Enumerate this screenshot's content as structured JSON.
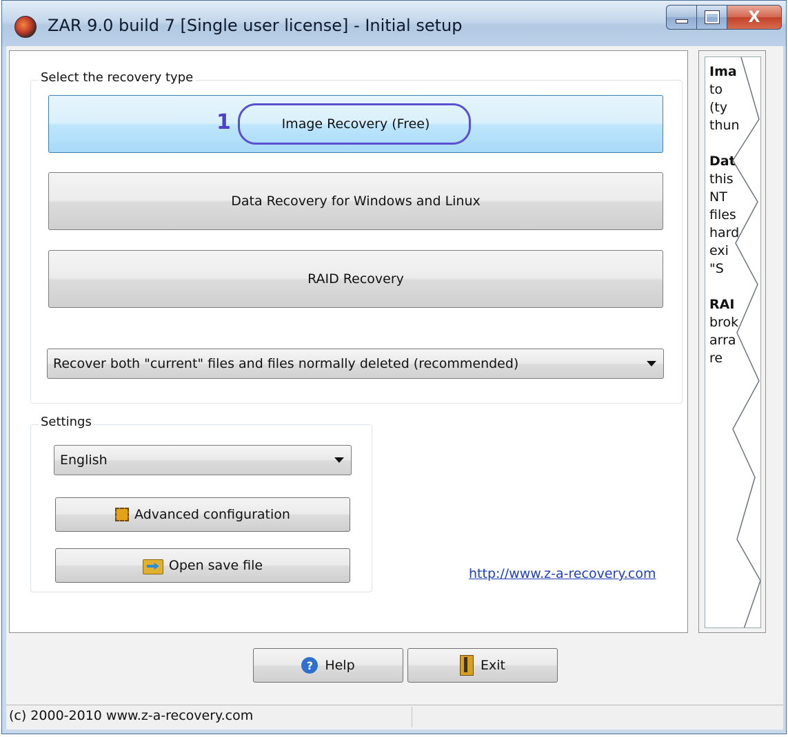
{
  "window": {
    "title": "ZAR 9.0 build 7 [Single user license] - Initial setup",
    "close_glyph": "X"
  },
  "recovery": {
    "group_label": "Select the recovery type",
    "step_marker": "1",
    "buttons": [
      {
        "label": "Image Recovery (Free)",
        "selected": true
      },
      {
        "label": "Data Recovery for Windows and Linux",
        "selected": false
      },
      {
        "label": "RAID Recovery",
        "selected": false
      }
    ],
    "mode_select": "Recover both \"current\" files and files normally deleted (recommended)"
  },
  "settings": {
    "group_label": "Settings",
    "language": "English",
    "advanced_label": "Advanced configuration",
    "open_save_label": "Open save file"
  },
  "link_text": "http://www.z-a-recovery.com",
  "side_panel": {
    "lines": [
      "Ima",
      "to",
      "(ty",
      "thun",
      "",
      "Data",
      "this",
      "NT",
      "files",
      "hard",
      "exi",
      "\"S",
      "",
      "RAI",
      "brok",
      "arra",
      "re"
    ]
  },
  "footer": {
    "help_label": "Help",
    "help_glyph": "?",
    "exit_label": "Exit"
  },
  "status": {
    "text": "(c) 2000-2010 www.z-a-recovery.com"
  },
  "colors": {
    "highlight_ring": "#5a4fd0",
    "step_number": "#4e40c8",
    "active_button": "#bee6fd",
    "link": "#1f3fbf"
  },
  "icons": {
    "app": "zar-app-icon",
    "advanced": "chip-icon",
    "open_save": "folder-arrow-icon",
    "help": "help-question-icon",
    "exit": "exit-door-icon"
  }
}
